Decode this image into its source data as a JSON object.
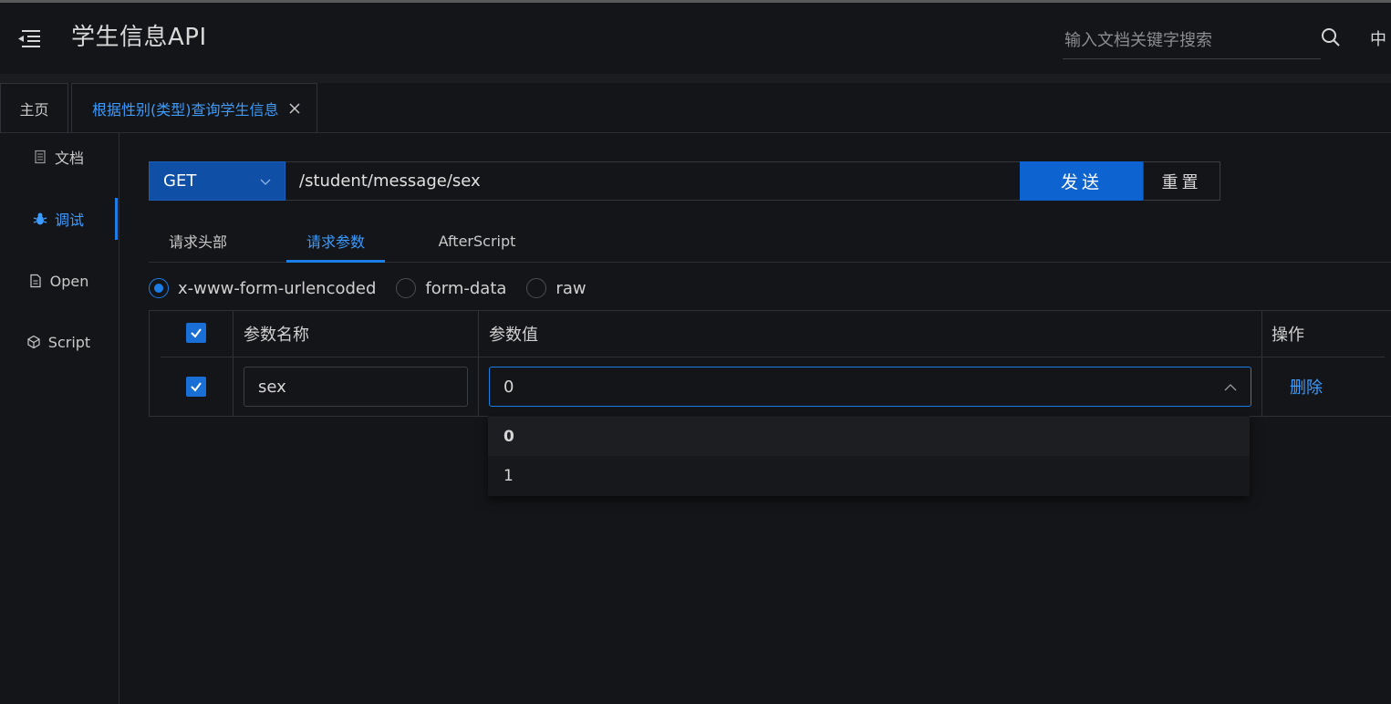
{
  "header": {
    "title": "学生信息API",
    "search_placeholder": "输入文档关键字搜索",
    "lang": "中"
  },
  "tabs": [
    {
      "label": "主页"
    },
    {
      "label": "根据性别(类型)查询学生信息"
    }
  ],
  "sidebar": {
    "items": [
      {
        "label": "文档",
        "icon": "document-icon"
      },
      {
        "label": "调试",
        "icon": "bug-icon"
      },
      {
        "label": "Open",
        "icon": "file-icon"
      },
      {
        "label": "Script",
        "icon": "cube-icon"
      }
    ]
  },
  "request": {
    "method": "GET",
    "url": "/student/message/sex",
    "send_label": "发送",
    "reset_label": "重置"
  },
  "subtabs": [
    {
      "label": "请求头部"
    },
    {
      "label": "请求参数"
    },
    {
      "label": "AfterScript"
    }
  ],
  "body_types": [
    {
      "label": "x-www-form-urlencoded",
      "selected": true
    },
    {
      "label": "form-data",
      "selected": false
    },
    {
      "label": "raw",
      "selected": false
    }
  ],
  "params_table": {
    "columns": [
      "参数名称",
      "参数值",
      "操作"
    ],
    "rows": [
      {
        "checked": true,
        "name": "sex",
        "value": "0",
        "action": "删除"
      }
    ]
  },
  "dropdown": {
    "options": [
      "0",
      "1"
    ],
    "selected": "0"
  },
  "colors": {
    "accent": "#1a7ee6",
    "link": "#3c9bff",
    "background": "#141518"
  }
}
